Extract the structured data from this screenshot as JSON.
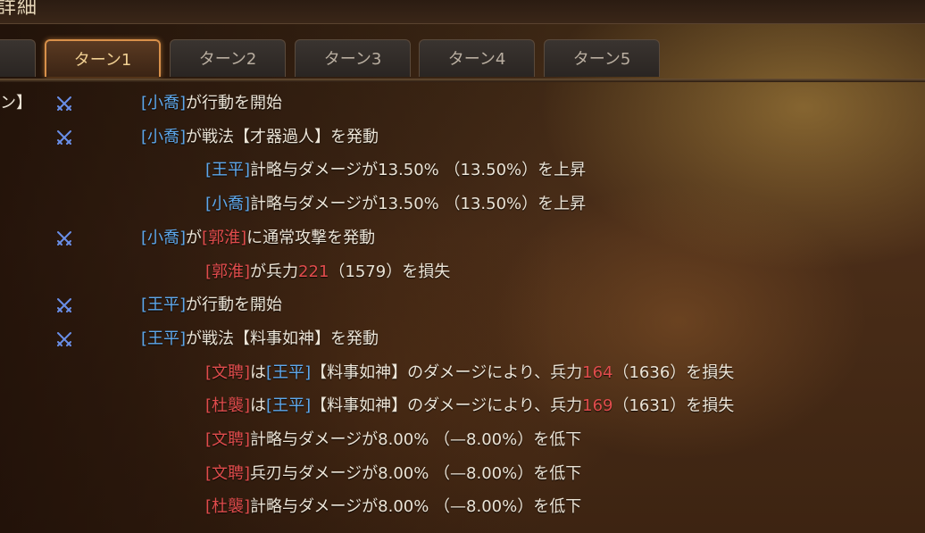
{
  "window": {
    "title": "詳細"
  },
  "tabs": [
    {
      "label": "ターン1",
      "active": true
    },
    {
      "label": "ターン2",
      "active": false
    },
    {
      "label": "ターン3",
      "active": false
    },
    {
      "label": "ターン4",
      "active": false
    },
    {
      "label": "ターン5",
      "active": false
    }
  ],
  "log_header_partial": "ン】",
  "log": [
    {
      "icon": true,
      "parts": [
        [
          "blue",
          "[小喬]"
        ],
        [
          "",
          "が行動を開始"
        ]
      ]
    },
    {
      "icon": true,
      "parts": [
        [
          "blue",
          "[小喬]"
        ],
        [
          "",
          "が戦法【才器過人】を発動"
        ]
      ]
    },
    {
      "icon": false,
      "parts": [
        [
          "blue",
          "[王平]"
        ],
        [
          "",
          "計略与ダメージが13.50% （13.50%）を上昇"
        ]
      ]
    },
    {
      "icon": false,
      "parts": [
        [
          "blue",
          "[小喬]"
        ],
        [
          "",
          "計略与ダメージが13.50% （13.50%）を上昇"
        ]
      ]
    },
    {
      "icon": true,
      "parts": [
        [
          "blue",
          "[小喬]"
        ],
        [
          "",
          "が"
        ],
        [
          "red",
          "[郭淮]"
        ],
        [
          "",
          "に通常攻撃を発動"
        ]
      ]
    },
    {
      "icon": false,
      "parts": [
        [
          "red",
          "[郭淮]"
        ],
        [
          "",
          "が兵力"
        ],
        [
          "red",
          "221"
        ],
        [
          "",
          "（1579）を損失"
        ]
      ]
    },
    {
      "icon": true,
      "parts": [
        [
          "blue",
          "[王平]"
        ],
        [
          "",
          "が行動を開始"
        ]
      ]
    },
    {
      "icon": true,
      "parts": [
        [
          "blue",
          "[王平]"
        ],
        [
          "",
          "が戦法【料事如神】を発動"
        ]
      ]
    },
    {
      "icon": false,
      "parts": [
        [
          "red",
          "[文聘]"
        ],
        [
          "",
          "は"
        ],
        [
          "blue",
          "[王平]"
        ],
        [
          "",
          "【料事如神】のダメージにより、兵力"
        ],
        [
          "red",
          "164"
        ],
        [
          "",
          "（1636）を損失"
        ]
      ]
    },
    {
      "icon": false,
      "parts": [
        [
          "red",
          "[杜襲]"
        ],
        [
          "",
          "は"
        ],
        [
          "blue",
          "[王平]"
        ],
        [
          "",
          "【料事如神】のダメージにより、兵力"
        ],
        [
          "red",
          "169"
        ],
        [
          "",
          "（1631）を損失"
        ]
      ]
    },
    {
      "icon": false,
      "parts": [
        [
          "red",
          "[文聘]"
        ],
        [
          "",
          "計略与ダメージが8.00% （—8.00%）を低下"
        ]
      ]
    },
    {
      "icon": false,
      "parts": [
        [
          "red",
          "[文聘]"
        ],
        [
          "",
          "兵刃与ダメージが8.00% （—8.00%）を低下"
        ]
      ]
    },
    {
      "icon": false,
      "parts": [
        [
          "red",
          "[杜襲]"
        ],
        [
          "",
          "計略与ダメージが8.00% （—8.00%）を低下"
        ]
      ]
    }
  ],
  "icon_name": "crossed-swords-icon",
  "colors": {
    "ally": "#5ea8ec",
    "enemy": "#e04c4c",
    "active_tab": "#d8904a"
  }
}
